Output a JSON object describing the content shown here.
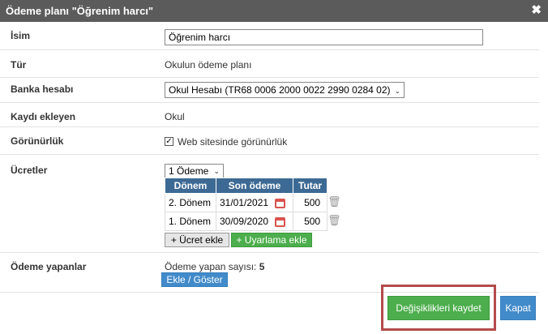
{
  "dialog": {
    "title": "Ödeme planı \"Öğrenim harcı\"",
    "close_glyph": "✖"
  },
  "fields": {
    "name": {
      "label": "İsim",
      "value": "Öğrenim harcı"
    },
    "type": {
      "label": "Tür",
      "value": "Okulun ödeme planı"
    },
    "bank": {
      "label": "Banka hesabı",
      "value": "Okul Hesabı (TR68 0006 2000 0022 2990 0284 02)"
    },
    "added_by": {
      "label": "Kaydı ekleyen",
      "value": "Okul"
    },
    "visibility": {
      "label": "Görünürlük",
      "checkbox_label": "Web sitesinde görünürlük",
      "checked": true
    },
    "fees": {
      "label": "Ücretler",
      "installments_select": "1 Ödeme",
      "columns": [
        "Dönem",
        "Son ödeme",
        "Tutar"
      ],
      "rows": [
        {
          "period": "2. Dönem",
          "due": "31/01/2021",
          "amount": "500"
        },
        {
          "period": "1. Dönem",
          "due": "30/09/2020",
          "amount": "500"
        }
      ],
      "add_fee_label": "+ Ücret ekle",
      "add_warning_label": "+ Uyarlama ekle"
    },
    "payers": {
      "label": "Ödeme yapanlar",
      "count_text": "Ödeme yapan sayısı:",
      "count": "5",
      "button_label": "Ekle / Göster"
    }
  },
  "footer": {
    "save_label": "Değişiklikleri kaydet",
    "close_label": "Kapat"
  },
  "colors": {
    "title_bg": "#5b5b5b",
    "table_header": "#3d6a94",
    "green": "#4cae4c",
    "blue": "#428bca",
    "highlight": "#b54a4a"
  }
}
